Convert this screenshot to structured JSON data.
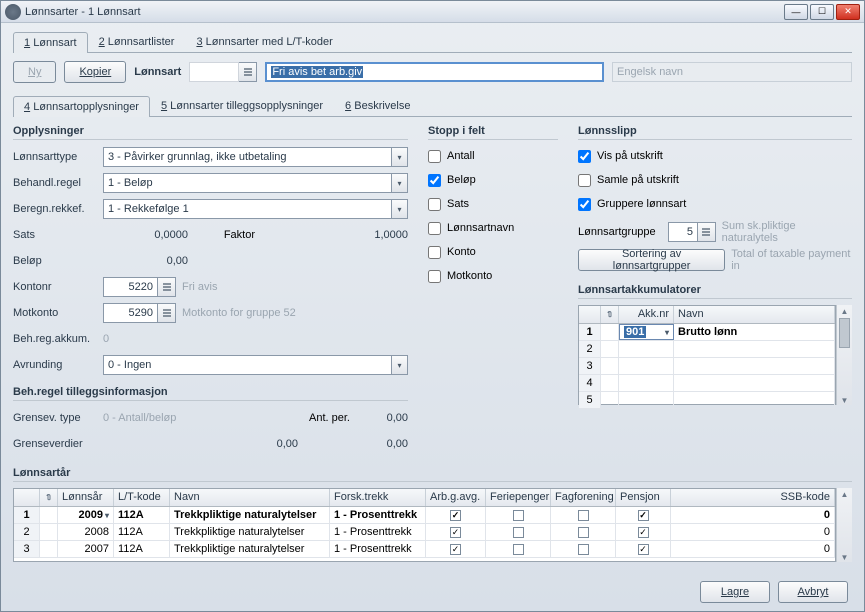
{
  "window": {
    "title": "Lønnsarter - 1 Lønnsart"
  },
  "tabs": {
    "main": [
      {
        "n": "1",
        "label": "Lønnsart",
        "active": true
      },
      {
        "n": "2",
        "label": "Lønnsartlister"
      },
      {
        "n": "3",
        "label": "Lønnsarter med L/T-koder"
      }
    ],
    "sub": [
      {
        "n": "4",
        "label": "Lønnsartopplysninger",
        "active": true
      },
      {
        "n": "5",
        "label": "Lønnsarter tilleggsopplysninger"
      },
      {
        "n": "6",
        "label": "Beskrivelse"
      }
    ]
  },
  "toolbar": {
    "new": "Ny",
    "copy": "Kopier",
    "label": "Lønnsart",
    "code": "",
    "name": "Fri avis bet arb.giv",
    "engname_ph": "Engelsk navn"
  },
  "opp": {
    "h": "Opplysninger",
    "type_l": "Lønnsarttype",
    "type_v": "3 - Påvirker grunnlag, ikke utbetaling",
    "beh_l": "Behandl.regel",
    "beh_v": "1 - Beløp",
    "ber_l": "Beregn.rekkef.",
    "ber_v": "1 - Rekkefølge 1",
    "sats_l": "Sats",
    "sats_v": "0,0000",
    "faktor_l": "Faktor",
    "faktor_v": "1,0000",
    "belop_l": "Beløp",
    "belop_v": "0,00",
    "konto_l": "Kontonr",
    "konto_v": "5220",
    "konto_h": "Fri avis",
    "mot_l": "Motkonto",
    "mot_v": "5290",
    "mot_h": "Motkonto for gruppe 52",
    "bra_l": "Beh.reg.akkum.",
    "bra_v": "0",
    "avr_l": "Avrunding",
    "avr_v": "0 - Ingen"
  },
  "tillegg": {
    "h": "Beh.regel tilleggsinformasjon",
    "g1_l": "Grensev. type",
    "g1_v": "0 - Antall/beløp",
    "ant_l": "Ant. per.",
    "ant_v": "0,00",
    "g2_l": "Grenseverdier",
    "g2_v": "0,00",
    "g2_v2": "0,00"
  },
  "stopp": {
    "h": "Stopp i felt",
    "items": [
      {
        "label": "Antall",
        "checked": false
      },
      {
        "label": "Beløp",
        "checked": true
      },
      {
        "label": "Sats",
        "checked": false
      },
      {
        "label": "Lønnsartnavn",
        "checked": false
      },
      {
        "label": "Konto",
        "checked": false
      },
      {
        "label": "Motkonto",
        "checked": false
      }
    ]
  },
  "slip": {
    "h": "Lønnsslipp",
    "items": [
      {
        "label": "Vis på utskrift",
        "checked": true
      },
      {
        "label": "Samle på utskrift",
        "checked": false
      },
      {
        "label": "Gruppere lønnsart",
        "checked": true
      }
    ],
    "grp_l": "Lønnsartgruppe",
    "grp_v": "5",
    "grp_h": "Sum sk.pliktige naturalytels",
    "sort_btn": "Sortering av lønnsartgrupper",
    "sort_h": "Total of taxable payment in"
  },
  "akk": {
    "h": "Lønnsartakkumulatorer",
    "cols": {
      "nr": "Akk.nr",
      "navn": "Navn"
    },
    "rows": [
      {
        "n": "1",
        "nr": "901",
        "navn": "Brutto lønn",
        "sel": true
      },
      {
        "n": "2"
      },
      {
        "n": "3"
      },
      {
        "n": "4"
      },
      {
        "n": "5"
      }
    ]
  },
  "yr": {
    "h": "Lønnsartår",
    "cols": {
      "ar": "Lønnsår",
      "lt": "L/T-kode",
      "navn": "Navn",
      "forsk": "Forsk.trekk",
      "arb": "Arb.g.avg.",
      "fer": "Feriepenger",
      "fag": "Fagforening",
      "pen": "Pensjon",
      "ssb": "SSB-kode"
    },
    "rows": [
      {
        "n": "1",
        "ar": "2009",
        "lt": "112A",
        "navn": "Trekkpliktige naturalytelser",
        "forsk": "1 - Prosenttrekk",
        "arb": true,
        "fer": false,
        "fag": false,
        "pen": true,
        "ssb": "0",
        "sel": true,
        "dd": true
      },
      {
        "n": "2",
        "ar": "2008",
        "lt": "112A",
        "navn": "Trekkpliktige naturalytelser",
        "forsk": "1 - Prosenttrekk",
        "arb": true,
        "fer": false,
        "fag": false,
        "pen": true,
        "ssb": "0"
      },
      {
        "n": "3",
        "ar": "2007",
        "lt": "112A",
        "navn": "Trekkpliktige naturalytelser",
        "forsk": "1 - Prosenttrekk",
        "arb": true,
        "fer": false,
        "fag": false,
        "pen": true,
        "ssb": "0"
      }
    ]
  },
  "buttons": {
    "save": "Lagre",
    "cancel": "Avbryt"
  }
}
